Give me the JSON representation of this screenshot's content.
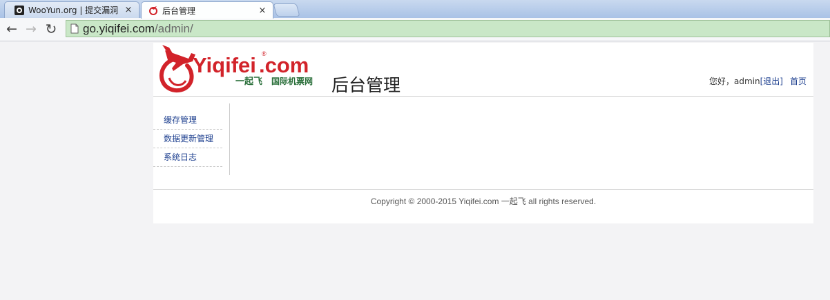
{
  "browser": {
    "tabs": [
      {
        "title": "WooYun.org | 提交漏洞",
        "close": "×",
        "active": false
      },
      {
        "title": "后台管理",
        "close": "×",
        "active": true
      }
    ],
    "nav": {
      "back": "←",
      "forward": "→",
      "reload": "↻"
    },
    "url": {
      "host": "go.yiqifei.com",
      "path": "/admin/"
    }
  },
  "header": {
    "logo_text": "Yiqifei.com",
    "logo_subtitle": "一起飞 国际机票网",
    "logo_registered": "®",
    "title": "后台管理",
    "greeting": "您好，admin",
    "logout": "[退出]",
    "home": "首页"
  },
  "sidebar": {
    "items": [
      {
        "label": "缓存管理"
      },
      {
        "label": "数据更新管理"
      },
      {
        "label": "系统日志"
      }
    ]
  },
  "footer": {
    "copyright": "Copyright © 2000-2015 Yiqifei.com 一起飞 all rights reserved."
  },
  "colors": {
    "brand_red": "#d2232a",
    "brand_green": "#2a6f3a",
    "link_blue": "#1d3f8f",
    "omnibox_green": "#c9e7c7"
  }
}
